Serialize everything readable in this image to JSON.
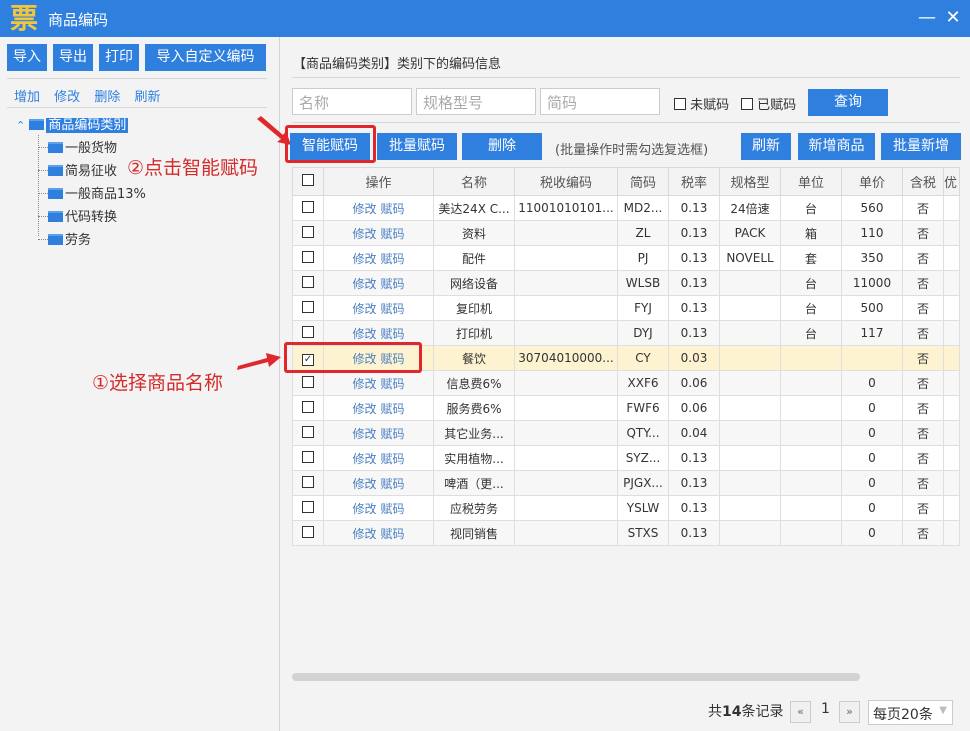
{
  "window": {
    "title": "商品编码",
    "logo_glyph": "票",
    "minimize_icon": "—",
    "close_icon": "✕"
  },
  "left": {
    "buttons": [
      "导入",
      "导出",
      "打印",
      "导入自定义编码"
    ],
    "links": [
      "增加",
      "修改",
      "删除",
      "刷新"
    ],
    "tree": {
      "root": {
        "label": "商品编码类别",
        "expand_icon": "⌃"
      },
      "children": [
        "一般货物",
        "简易征收",
        "一般商品13%",
        "代码转换",
        "劳务"
      ]
    }
  },
  "annotations": {
    "step1": "①选择商品名称",
    "step2": "②点击智能赋码"
  },
  "main": {
    "heading": "【商品编码类别】类别下的编码信息",
    "search": {
      "name_placeholder": "名称",
      "spec_placeholder": "规格型号",
      "abbr_placeholder": "简码",
      "unassigned_label": "未赋码",
      "assigned_label": "已赋码",
      "query_button": "查询"
    },
    "toolbar": {
      "smart_assign": "智能赋码",
      "batch_assign": "批量赋码",
      "delete": "删除",
      "hint": "(批量操作时需勾选复选框)",
      "refresh": "刷新",
      "add_product": "新增商品",
      "batch_add": "批量新增"
    },
    "table": {
      "columns": [
        "操作",
        "名称",
        "税收编码",
        "简码",
        "税率",
        "规格型",
        "单位",
        "单价",
        "含税",
        "优"
      ],
      "op_edit": "修改",
      "op_assign": "赋码",
      "rows": [
        {
          "checked": false,
          "name": "美达24X C...",
          "tax_code": "11001010101...",
          "abbr": "MD2...",
          "rate": "0.13",
          "spec": "24倍速",
          "unit": "台",
          "price": "560",
          "tax_incl": "否"
        },
        {
          "checked": false,
          "name": "资料",
          "tax_code": "",
          "abbr": "ZL",
          "rate": "0.13",
          "spec": "PACK",
          "unit": "箱",
          "price": "110",
          "tax_incl": "否"
        },
        {
          "checked": false,
          "name": "配件",
          "tax_code": "",
          "abbr": "PJ",
          "rate": "0.13",
          "spec": "NOVELL",
          "unit": "套",
          "price": "350",
          "tax_incl": "否"
        },
        {
          "checked": false,
          "name": "网络设备",
          "tax_code": "",
          "abbr": "WLSB",
          "rate": "0.13",
          "spec": "",
          "unit": "台",
          "price": "11000",
          "tax_incl": "否"
        },
        {
          "checked": false,
          "name": "复印机",
          "tax_code": "",
          "abbr": "FYJ",
          "rate": "0.13",
          "spec": "",
          "unit": "台",
          "price": "500",
          "tax_incl": "否"
        },
        {
          "checked": false,
          "name": "打印机",
          "tax_code": "",
          "abbr": "DYJ",
          "rate": "0.13",
          "spec": "",
          "unit": "台",
          "price": "117",
          "tax_incl": "否"
        },
        {
          "checked": true,
          "name": "餐饮",
          "tax_code": "30704010000...",
          "abbr": "CY",
          "rate": "0.03",
          "spec": "",
          "unit": "",
          "price": "",
          "tax_incl": "否"
        },
        {
          "checked": false,
          "name": "信息费6%",
          "tax_code": "",
          "abbr": "XXF6",
          "rate": "0.06",
          "spec": "",
          "unit": "",
          "price": "0",
          "tax_incl": "否"
        },
        {
          "checked": false,
          "name": "服务费6%",
          "tax_code": "",
          "abbr": "FWF6",
          "rate": "0.06",
          "spec": "",
          "unit": "",
          "price": "0",
          "tax_incl": "否"
        },
        {
          "checked": false,
          "name": "其它业务...",
          "tax_code": "",
          "abbr": "QTY...",
          "rate": "0.04",
          "spec": "",
          "unit": "",
          "price": "0",
          "tax_incl": "否"
        },
        {
          "checked": false,
          "name": "实用植物...",
          "tax_code": "",
          "abbr": "SYZ...",
          "rate": "0.13",
          "spec": "",
          "unit": "",
          "price": "0",
          "tax_incl": "否"
        },
        {
          "checked": false,
          "name": "啤酒（更...",
          "tax_code": "",
          "abbr": "PJGX...",
          "rate": "0.13",
          "spec": "",
          "unit": "",
          "price": "0",
          "tax_incl": "否"
        },
        {
          "checked": false,
          "name": "应税劳务",
          "tax_code": "",
          "abbr": "YSLW",
          "rate": "0.13",
          "spec": "",
          "unit": "",
          "price": "0",
          "tax_incl": "否"
        },
        {
          "checked": false,
          "name": "视同销售",
          "tax_code": "",
          "abbr": "STXS",
          "rate": "0.13",
          "spec": "",
          "unit": "",
          "price": "0",
          "tax_incl": "否"
        }
      ]
    },
    "pager": {
      "total_prefix": "共",
      "total_count": "14",
      "total_suffix": "条记录",
      "prev": "«",
      "page": "1",
      "next": "»",
      "page_size": "每页20条"
    }
  }
}
